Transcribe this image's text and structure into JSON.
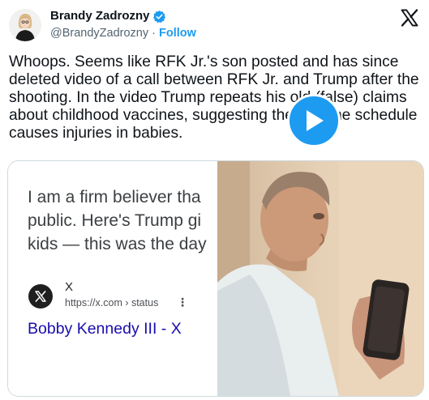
{
  "author": {
    "name": "Brandy Zadrozny",
    "handle": "@BrandyZadrozny",
    "separator": "·",
    "follow_label": "Follow"
  },
  "tweet": {
    "text": "Whoops. Seems like RFK Jr.'s son posted and has since deleted video of a call between RFK Jr. and Trump after the shooting. In the video Trump repeats his old (false) claims about childhood vaccines, suggesting the vaccine schedule causes injuries in babies."
  },
  "media": {
    "screenshot_lines": [
      "I am a firm believer tha",
      "public. Here's Trump gi",
      "kids — this was the day"
    ],
    "result": {
      "site_name": "X",
      "url": "https://x.com › status",
      "menu": "⋮",
      "title": "Bobby Kennedy III - X"
    }
  },
  "icons": {
    "verified": "verified-badge-icon",
    "x_logo": "x-logo-icon",
    "play": "play-icon"
  },
  "colors": {
    "link_blue": "#1d9bf0",
    "search_title_blue": "#1a0dab",
    "text": "#0f1419",
    "secondary_text": "#536471"
  }
}
